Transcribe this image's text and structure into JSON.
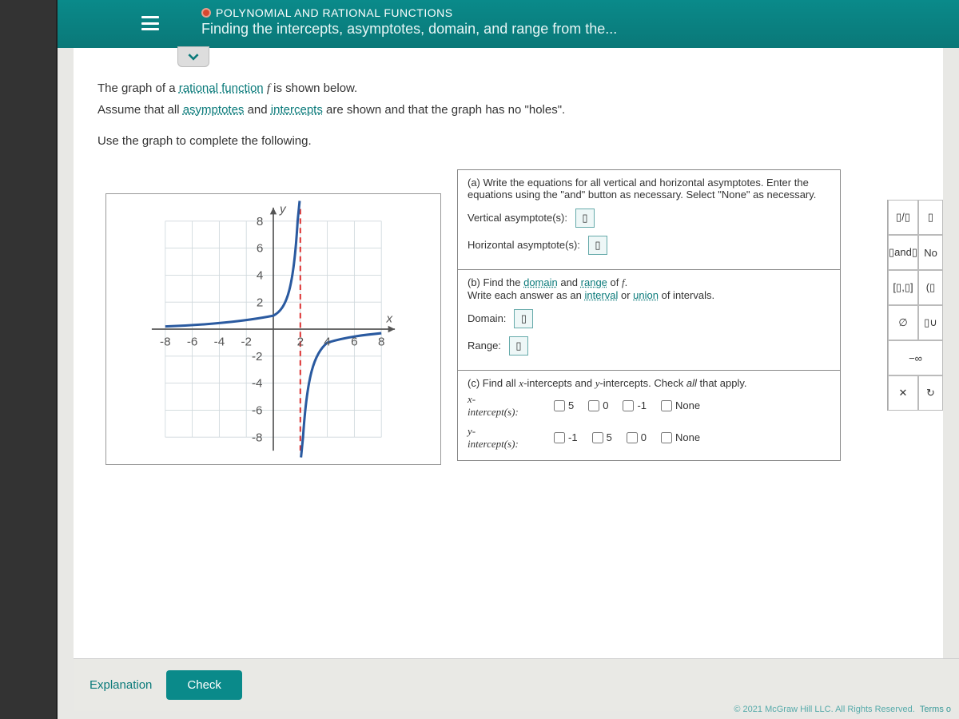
{
  "header": {
    "section": "POLYNOMIAL AND RATIONAL FUNCTIONS",
    "title": "Finding the intercepts, asymptotes, domain, and range from the..."
  },
  "prompt": {
    "line1_a": "The graph of a ",
    "line1_link": "rational function",
    "line1_b": " ",
    "line1_f": "f",
    "line1_c": " is shown below.",
    "line2_a": "Assume that all ",
    "line2_link1": "asymptotes",
    "line2_b": " and ",
    "line2_link2": "intercepts",
    "line2_c": " are shown and that the graph has no \"holes\".",
    "line3": "Use the graph to complete the following."
  },
  "parts": {
    "a": {
      "text": "(a) Write the equations for all vertical and horizontal asymptotes. Enter the equations using the \"and\" button as necessary. Select \"None\" as necessary.",
      "va_label": "Vertical asymptote(s):",
      "ha_label": "Horizontal asymptote(s):"
    },
    "b": {
      "text_a": "(b) Find the ",
      "link1": "domain",
      "text_b": " and ",
      "link2": "range",
      "text_c": " of ",
      "f": "f",
      "text_d": ".",
      "text_e": "Write each answer as an ",
      "link3": "interval",
      "text_f": " or ",
      "link4": "union",
      "text_g": " of intervals.",
      "domain_label": "Domain:",
      "range_label": "Range:"
    },
    "c": {
      "text_a": "(c) Find all ",
      "xint": "x",
      "text_b": "-intercepts and ",
      "yint": "y",
      "text_c": "-intercepts. Check ",
      "all": "all",
      "text_d": " that apply.",
      "x_label": "x-\nintercept(s):",
      "y_label": "y-\nintercept(s):",
      "x_opts": [
        "5",
        "0",
        "-1",
        "None"
      ],
      "y_opts": [
        "-1",
        "5",
        "0",
        "None"
      ]
    }
  },
  "palette": {
    "frac": "▯/▯",
    "sq": "▯",
    "and": "▯and▯",
    "no": "No",
    "closed": "[▯,▯]",
    "open": "(▯",
    "empty": "∅",
    "union": "▯∪",
    "neginf": "−∞",
    "x": "✕",
    "redo": "↻"
  },
  "footer": {
    "explain": "Explanation",
    "check": "Check",
    "copyright": "© 2021 McGraw Hill LLC. All Rights Reserved.",
    "terms": "Terms o"
  },
  "chart_data": {
    "type": "line",
    "title": "",
    "xlabel": "x",
    "ylabel": "y",
    "xlim": [
      -8,
      8
    ],
    "ylim": [
      -8,
      8
    ],
    "grid": true,
    "vertical_asymptotes": [
      2
    ],
    "horizontal_asymptotes": [
      0
    ],
    "series": [
      {
        "name": "left-branch",
        "x": [
          -8,
          -6,
          -4,
          -2,
          0,
          1,
          1.5,
          1.8,
          1.95
        ],
        "y": [
          0.2,
          0.25,
          0.35,
          0.55,
          1.0,
          1.8,
          3.5,
          8,
          20
        ]
      },
      {
        "name": "right-branch",
        "x": [
          2.05,
          2.2,
          2.5,
          3,
          4,
          5,
          6,
          7,
          8
        ],
        "y": [
          -20,
          -8,
          -3.5,
          -1.8,
          -1.0,
          -0.6,
          -0.45,
          -0.35,
          -0.3
        ]
      }
    ],
    "x_ticks": [
      -8,
      -6,
      -4,
      -2,
      2,
      4,
      6,
      8
    ],
    "y_ticks": [
      -8,
      -6,
      -4,
      -2,
      2,
      4,
      6,
      8
    ]
  }
}
